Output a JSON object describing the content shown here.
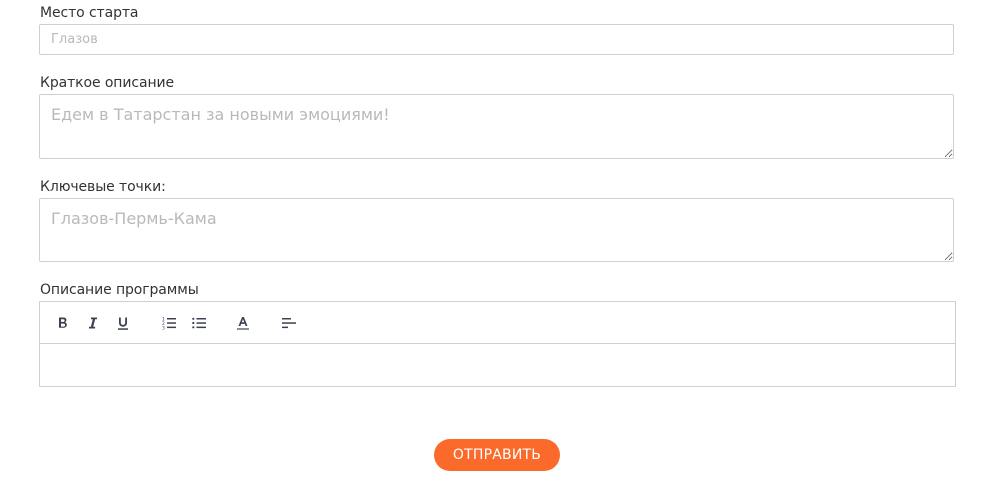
{
  "fields": {
    "start_place": {
      "label": "Место старта",
      "placeholder": "Глазов",
      "value": ""
    },
    "short_description": {
      "label": "Краткое описание",
      "placeholder": "Едем в Татарстан за новыми эмоциями!",
      "value": ""
    },
    "key_points": {
      "label": "Ключевые точки:",
      "placeholder": "Глазов-Пермь-Кама",
      "value": ""
    },
    "program_description": {
      "label": "Описание программы",
      "toolbar": [
        {
          "action": "bold",
          "icon": "bold-icon"
        },
        {
          "action": "italic",
          "icon": "italic-icon"
        },
        {
          "action": "underline",
          "icon": "underline-icon"
        },
        {
          "action": "ordered-list",
          "icon": "ordered-list-icon"
        },
        {
          "action": "bullet-list",
          "icon": "bullet-list-icon"
        },
        {
          "action": "text-color",
          "icon": "text-color-icon"
        },
        {
          "action": "align",
          "icon": "align-left-icon"
        }
      ],
      "value": ""
    }
  },
  "submit": {
    "label": "ОТПРАВИТЬ",
    "color": "#fb6a2a"
  }
}
